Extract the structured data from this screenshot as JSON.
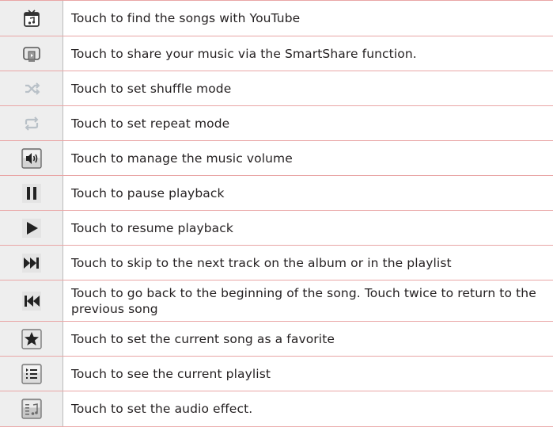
{
  "rows": [
    {
      "icon": "youtube-tv-icon",
      "description": "Touch to find the songs with YouTube"
    },
    {
      "icon": "smartshare-icon",
      "description": "Touch to share your music via the SmartShare function."
    },
    {
      "icon": "shuffle-icon",
      "description": "Touch to set shuffle mode"
    },
    {
      "icon": "repeat-icon",
      "description": "Touch to set repeat mode"
    },
    {
      "icon": "volume-icon",
      "description": "Touch to manage the music volume"
    },
    {
      "icon": "pause-icon",
      "description": "Touch to pause playback"
    },
    {
      "icon": "play-icon",
      "description": "Touch to resume playback"
    },
    {
      "icon": "skip-next-icon",
      "description": "Touch to skip to the next track on the album or in the playlist"
    },
    {
      "icon": "skip-previous-icon",
      "description": "Touch to go back to the beginning of the song. Touch twice to return to the previous song"
    },
    {
      "icon": "favorite-star-icon",
      "description": "Touch to set the current song as a favorite"
    },
    {
      "icon": "playlist-icon",
      "description": "Touch to see the current playlist"
    },
    {
      "icon": "audio-effect-icon",
      "description": "Touch to set the audio effect."
    }
  ],
  "colors": {
    "row_divider": "#e9a6a6",
    "icon_cell_bg": "#eeeeee",
    "text": "#231f20"
  }
}
